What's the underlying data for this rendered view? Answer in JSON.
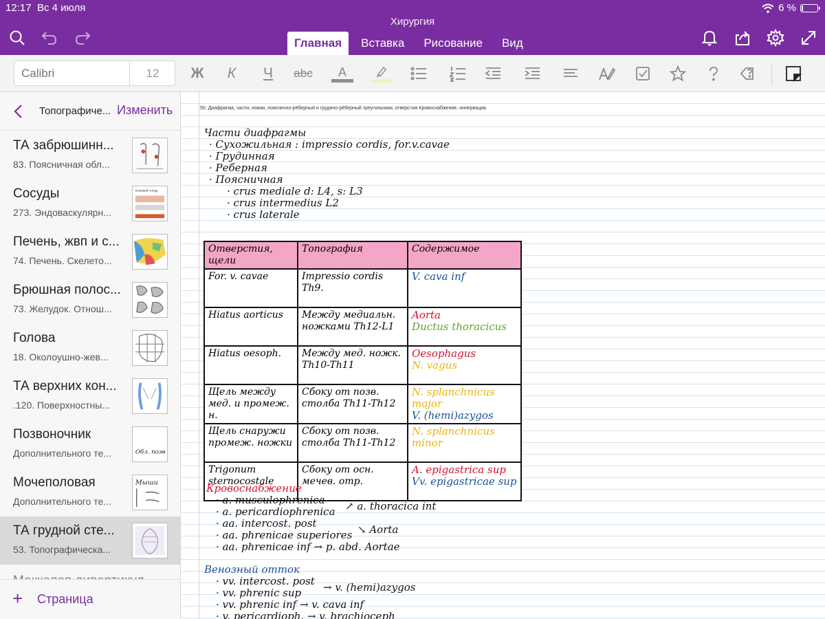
{
  "status_bar": {
    "time": "12:17",
    "date": "Вс 4 июля",
    "battery": "6 %",
    "battery_level": 0.06
  },
  "app": {
    "document_title": "Хирургия"
  },
  "toolbar": {
    "tabs": [
      {
        "label": "Главная",
        "active": true
      },
      {
        "label": "Вставка",
        "active": false
      },
      {
        "label": "Рисование",
        "active": false
      },
      {
        "label": "Вид",
        "active": false
      }
    ],
    "icons": [
      "search-icon",
      "undo-icon",
      "redo-icon",
      "bell-icon",
      "share-icon",
      "gear-icon",
      "expand-icon"
    ]
  },
  "ribbon": {
    "font_name_placeholder": "Calibri",
    "font_size": "12",
    "bold": "Ж",
    "italic": "К",
    "underline": "Ч",
    "strike": "abc",
    "font_color": "A"
  },
  "sidebar": {
    "section": "Топографиче...",
    "edit": "Изменить",
    "pages": [
      {
        "title": "ТА забрюшинн...",
        "subtitle": "83. Поясничная обл..."
      },
      {
        "title": "Сосуды",
        "subtitle": "273. Эндоваскулярн..."
      },
      {
        "title": "Печень, жвп и с...",
        "subtitle": "74. Печень. Скелето..."
      },
      {
        "title": "Брюшная полос...",
        "subtitle": "73. Желудок. Отнош..."
      },
      {
        "title": "Голова",
        "subtitle": "18. Околоушно-жев..."
      },
      {
        "title": "ТА верхних кон...",
        "subtitle": ".120. Поверхностны..."
      },
      {
        "title": "Позвоночник",
        "subtitle": "Дополнительного те..."
      },
      {
        "title": "Мочеполовая",
        "subtitle": "Дополнительного те..."
      },
      {
        "title": "ТА грудной сте...",
        "subtitle": "53. Топографическа..."
      }
    ],
    "peek": "Меккелев дивертикул",
    "add_page": "Страница",
    "thumb_labels": {
      "t2": "Боковой сосуд",
      "t7": "Обл. позв",
      "t8": "Мыши"
    }
  },
  "note": {
    "heading": "50. Диафрагма, части, ножки, пояснично-рёберный и грудино-рёберный треугольники, отверстия Кровоснабжение, иннервация.",
    "parts_title": "Части диафрагмы",
    "parts": [
      "· Сухожильная : impressio cordis, for.v.cavae",
      "· Грудинная",
      "· Реберная",
      "· Поясничная"
    ],
    "crura": [
      "· crus mediale  d: L4, s: L3",
      "· crus intermedius  L2",
      "· crus laterale"
    ],
    "table": {
      "headers": [
        "Отверстия, щели",
        "Топография",
        "Содержимое"
      ],
      "rows": [
        {
          "name": "For. v. cavae",
          "topo": "Impressio cordis Th9.",
          "content": [
            {
              "text": "V. cava inf",
              "color": "blue"
            }
          ]
        },
        {
          "name": "Hiatus aorticus",
          "topo": "Между медиальн. ножками Th12-L1",
          "content": [
            {
              "text": "Aorta",
              "color": "red"
            },
            {
              "text": "Ductus thoracicus",
              "color": "green"
            }
          ]
        },
        {
          "name": "Hiatus oesoph.",
          "topo": "Между мед. ножк. Th10-Th11",
          "content": [
            {
              "text": "Oesophagus",
              "color": "red"
            },
            {
              "text": "N. vagus",
              "color": "orange"
            }
          ]
        },
        {
          "name": "Щель между мед. и промеж. н.",
          "topo": "Сбоку от позв. столба Th11-Th12",
          "content": [
            {
              "text": "N. splanchnicus major",
              "color": "orange"
            },
            {
              "text": "V. (hemi)azygos",
              "color": "blue"
            }
          ]
        },
        {
          "name": "Щель снаружи промеж. ножки",
          "topo": "Сбоку от позв. столба Th11-Th12",
          "content": [
            {
              "text": "N. splanchnicus minor",
              "color": "orange"
            }
          ]
        },
        {
          "name": "Trigonum sternocostale",
          "topo": "Сбоку от осн. мечев. отр.",
          "content": [
            {
              "text": "A. epigastrica sup",
              "color": "red"
            },
            {
              "text": "Vv. epigastricae sup",
              "color": "blue"
            }
          ]
        }
      ]
    },
    "blood_title": "Кровоснабжение",
    "blood": [
      "· a. musculophrenica",
      "· a. pericardiophrenica",
      "· aa. intercost. post",
      "· aa. phrenicae superiores",
      "· aa. phrenicae inf → p. abd. Aortae"
    ],
    "blood_side1": "↗ a. thoracica int",
    "blood_side2": "↘ Aorta",
    "venous_title": "Венозный отток",
    "venous": [
      "· vv. intercost. post",
      "· vv. phrenic sup",
      "· vv. phrenic inf → v. cava inf",
      "· v. pericardioph. → v. brachioceph"
    ],
    "venous_side": "→ v. (hemi)azygos"
  }
}
